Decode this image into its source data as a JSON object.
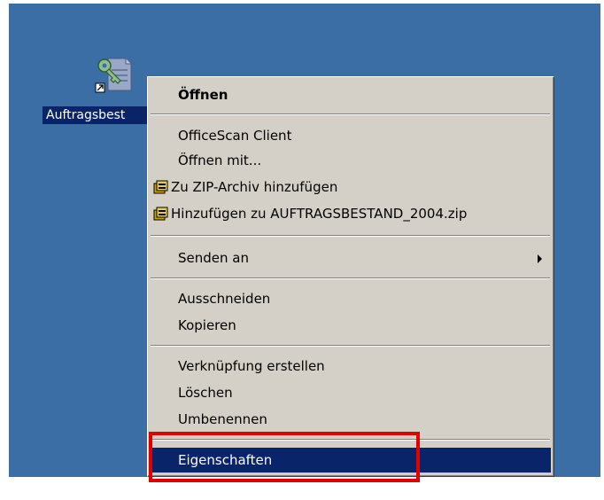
{
  "desktop": {
    "background": "#3a6ea5",
    "icon": {
      "name": "key-document-shortcut-icon",
      "caption": "Auftragsbest"
    }
  },
  "context_menu": {
    "items": [
      {
        "label": "Öffnen",
        "bold": true
      },
      {
        "label": "OfficeScan Client"
      },
      {
        "label": "Öffnen mit..."
      },
      {
        "label": "Zu ZIP-Archiv hinzufügen",
        "icon": "winzip-icon"
      },
      {
        "label": "Hinzufügen zu AUFTRAGSBESTAND_2004.zip",
        "icon": "winzip-icon"
      },
      {
        "label": "Senden an",
        "submenu": true
      },
      {
        "label": "Ausschneiden"
      },
      {
        "label": "Kopieren"
      },
      {
        "label": "Verknüpfung erstellen"
      },
      {
        "label": "Löschen"
      },
      {
        "label": "Umbenennen"
      },
      {
        "label": "Eigenschaften",
        "highlighted": true
      }
    ]
  },
  "annotation": {
    "color": "#e00000",
    "target": "Eigenschaften"
  }
}
